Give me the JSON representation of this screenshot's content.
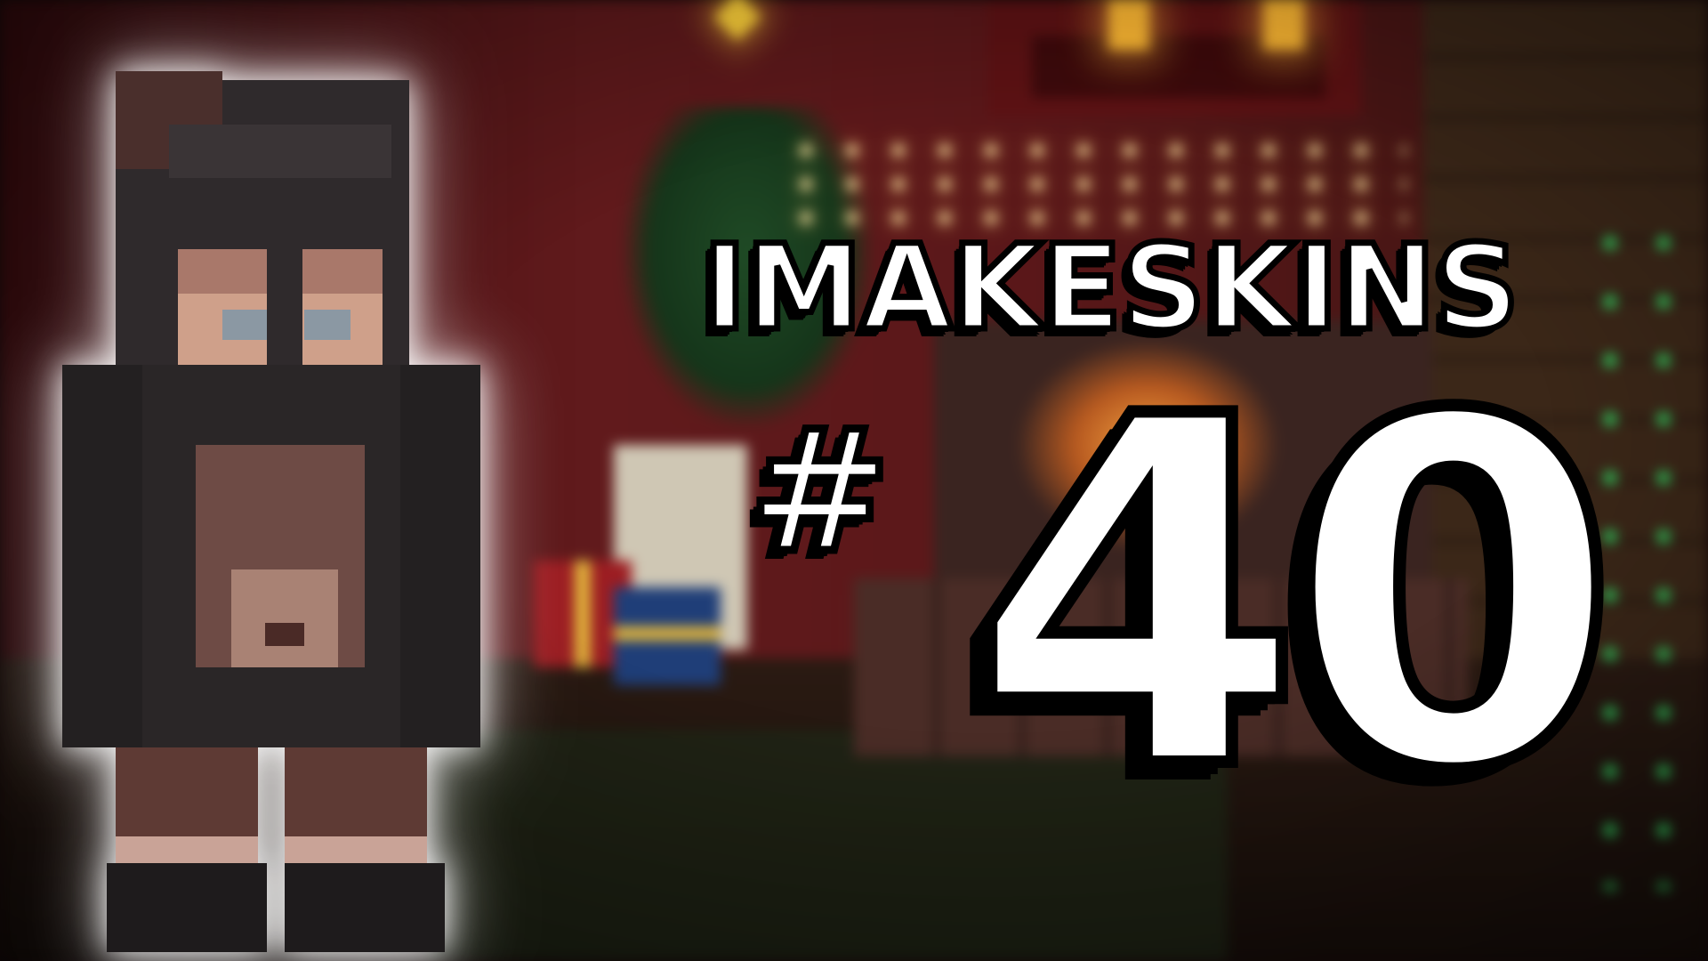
{
  "thumbnail": {
    "title": "IMAKESKINS",
    "hash_symbol": "#",
    "episode_number": "40"
  },
  "colors": {
    "text_fill": "#ffffff",
    "text_outline": "#000000",
    "character_glow": "#ffffff",
    "wall_red": "#5a1719",
    "fire_glow": "#f0a040",
    "green_lights": "#35e56a"
  },
  "icons": [
    "christmas-tree-icon",
    "star-icon",
    "lantern-icon",
    "gift-box-icon",
    "fireplace-icon"
  ]
}
